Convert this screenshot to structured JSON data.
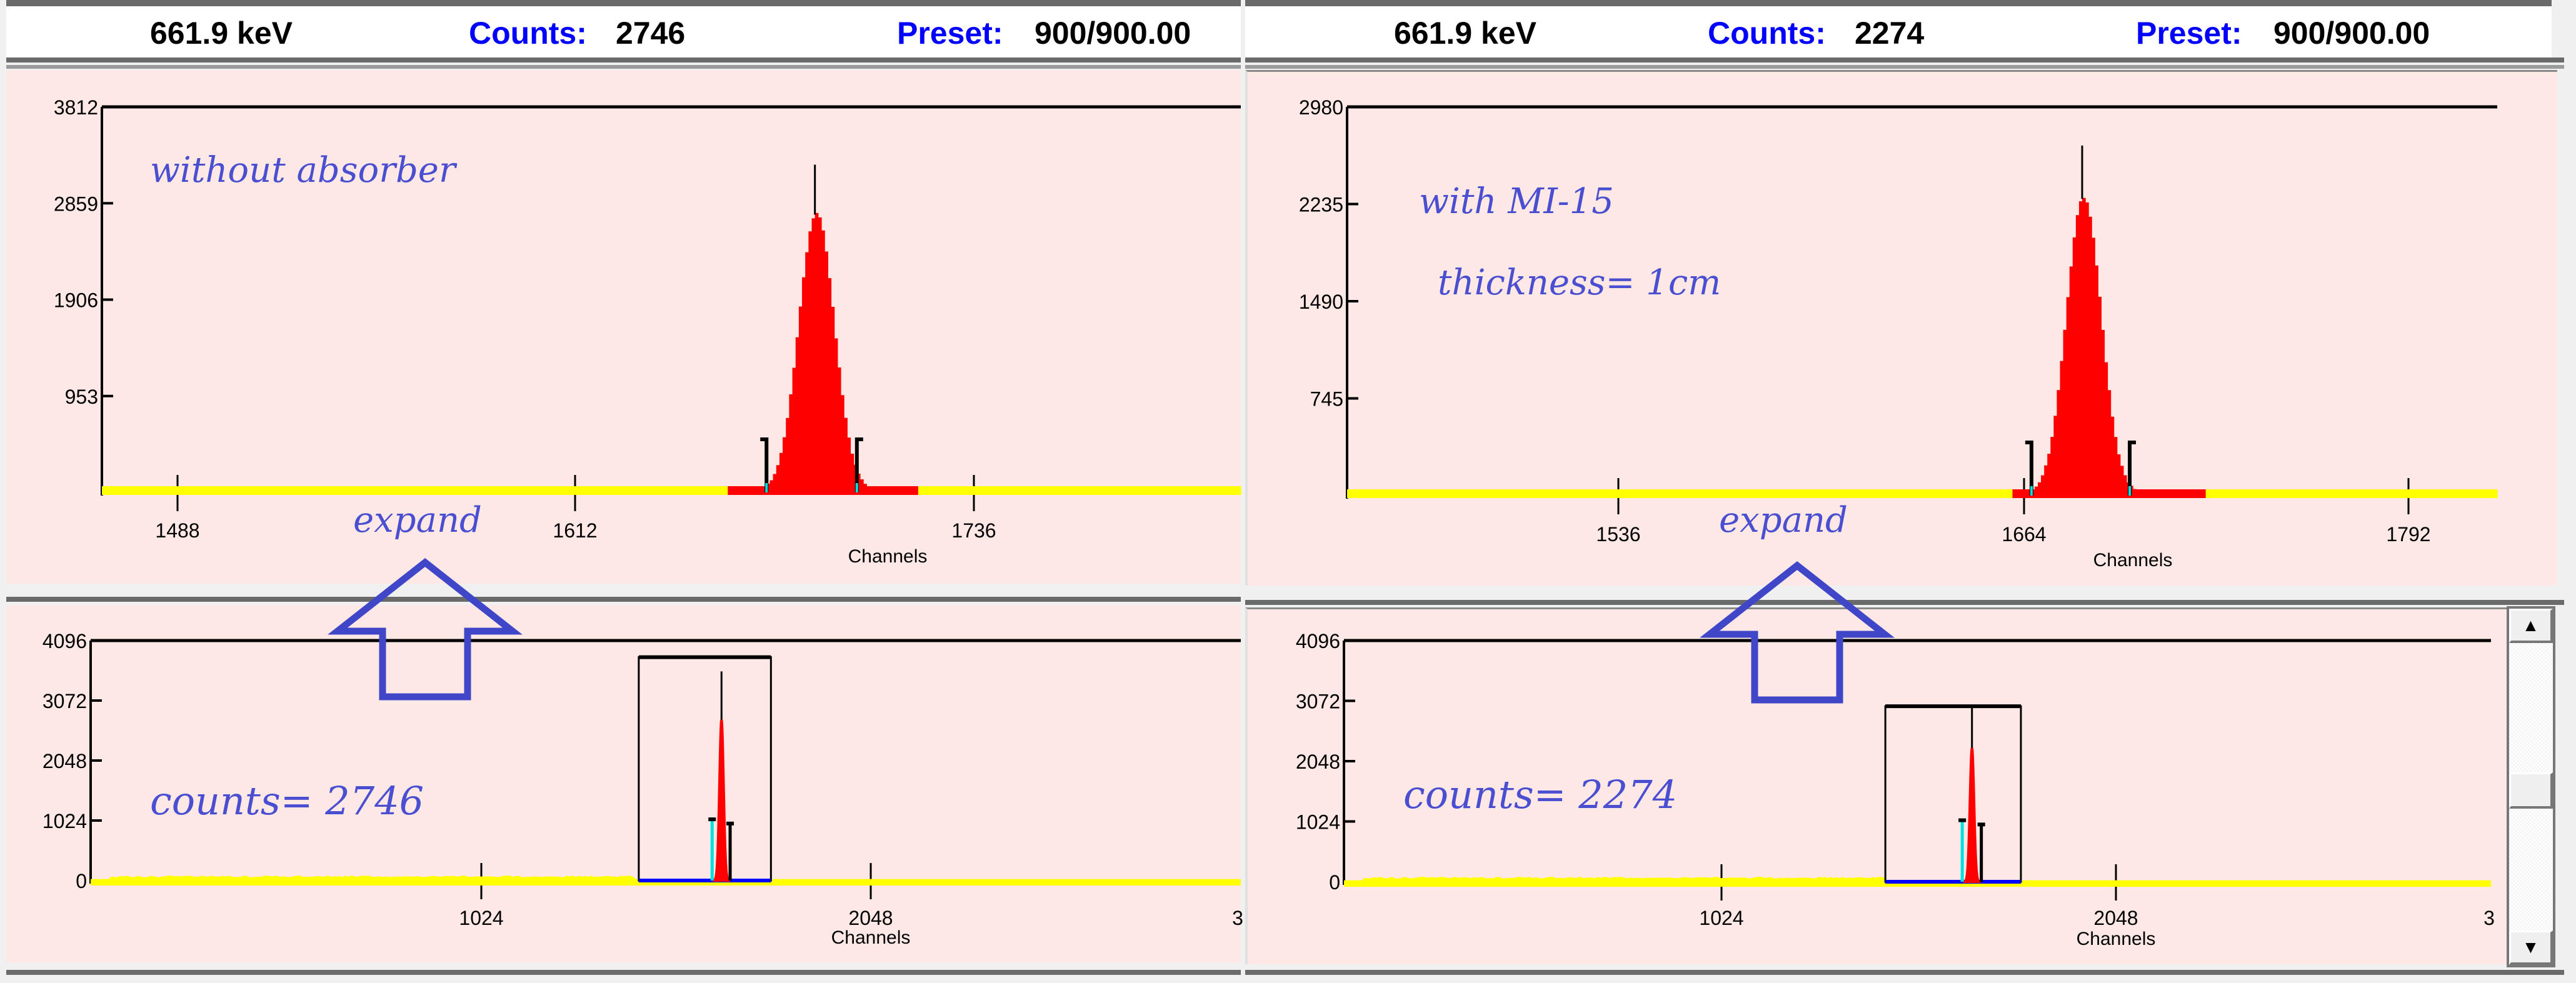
{
  "panels": [
    {
      "header": {
        "energy": "661.9 keV",
        "counts_label": "Counts:",
        "counts_value": "2746",
        "preset_label": "Preset:",
        "preset_value": "900/900.00"
      },
      "annotations": {
        "title": "without absorber",
        "counts_note": "counts= 2746",
        "expand_note": "expand"
      }
    },
    {
      "header": {
        "energy": "661.9 keV",
        "counts_label": "Counts:",
        "counts_value": "2274",
        "preset_label": "Preset:",
        "preset_value": "900/900.00"
      },
      "annotations": {
        "title": "with MI-15",
        "subtitle": "thickness= 1cm",
        "counts_note": "counts= 2274",
        "expand_note": "expand"
      }
    }
  ],
  "colors": {
    "background": "#fde8e6",
    "baseline": "#ffff00",
    "roi": "#ff0000",
    "roi_edge": "#00e0e0",
    "annotation": "#4a4ed0",
    "label": "#0000ff"
  },
  "chart_data": [
    {
      "type": "bar",
      "title": "without absorber (expanded)",
      "xlabel": "Channels",
      "ylabel": "",
      "xlim": [
        1464,
        1817
      ],
      "ylim": [
        0,
        3812
      ],
      "xticks": [
        "1488",
        "1612",
        "1736"
      ],
      "yticks": [
        "953",
        "1906",
        "2859",
        "3812"
      ],
      "peak": {
        "channel": 1685,
        "counts": 2746,
        "sigma": 5.5
      },
      "roi": [
        1670,
        1698
      ],
      "highlight": [
        1658,
        1716
      ]
    },
    {
      "type": "bar",
      "title": "with MI-15 thickness 1cm (expanded)",
      "xlabel": "Channels",
      "ylabel": "",
      "xlim": [
        1450,
        1813
      ],
      "ylim": [
        0,
        2980
      ],
      "xticks": [
        "1536",
        "1664",
        "1792"
      ],
      "yticks": [
        "745",
        "1490",
        "2235",
        "2980"
      ],
      "peak": {
        "channel": 1682,
        "counts": 2274,
        "sigma": 5.5
      },
      "roi": [
        1666,
        1697
      ],
      "highlight": [
        1660,
        1720
      ]
    },
    {
      "type": "bar",
      "title": "without absorber (full)",
      "xlabel": "Channels",
      "ylabel": "",
      "xlim": [
        0,
        3072
      ],
      "ylim": [
        0,
        4096
      ],
      "xticks": [
        "1024",
        "2048",
        "3"
      ],
      "yticks": [
        "0",
        "1024",
        "2048",
        "3072",
        "4096"
      ],
      "peak": {
        "channel": 1685,
        "counts": 2746,
        "sigma": 5.5
      },
      "roi": [
        1670,
        1698
      ],
      "zoom_box": [
        1464,
        1817,
        3812
      ]
    },
    {
      "type": "bar",
      "title": "with MI-15 (full)",
      "xlabel": "Channels",
      "ylabel": "",
      "xlim": [
        0,
        3072
      ],
      "ylim": [
        0,
        4096
      ],
      "xticks": [
        "1024",
        "2048",
        "3"
      ],
      "yticks": [
        "0",
        "1024",
        "2048",
        "3072",
        "4096"
      ],
      "peak": {
        "channel": 1682,
        "counts": 2274,
        "sigma": 5.5
      },
      "roi": [
        1666,
        1697
      ],
      "zoom_box": [
        1450,
        1813,
        2980
      ]
    }
  ]
}
